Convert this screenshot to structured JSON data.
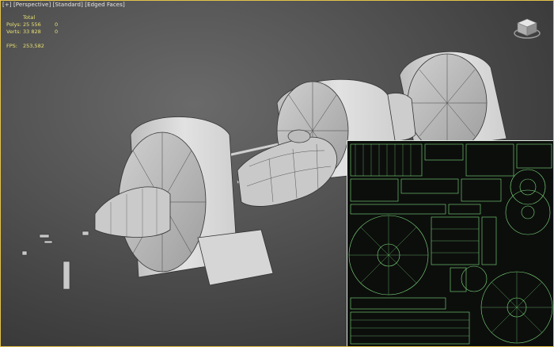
{
  "viewport": {
    "label_parts": [
      "[+]",
      "[Perspective]",
      "[Standard]",
      "[Edged Faces]"
    ],
    "frame_color": "#e3c24a"
  },
  "stats": {
    "header": "Total",
    "polys_label": "Polys:",
    "polys_total": "25 556",
    "polys_selected": "0",
    "verts_label": "Verts:",
    "verts_total": "33 828",
    "verts_selected": "0",
    "fps_label": "FPS:",
    "fps_value": "253,582",
    "text_color": "#e8e070"
  },
  "viewcube": {
    "icon": "viewcube-icon"
  },
  "uv_overlay": {
    "wire_color": "#7fe07f",
    "bg_color": "#0c0e0c"
  },
  "model": {
    "color": "#d8d8d8",
    "wire_color": "#2a2a2a"
  }
}
